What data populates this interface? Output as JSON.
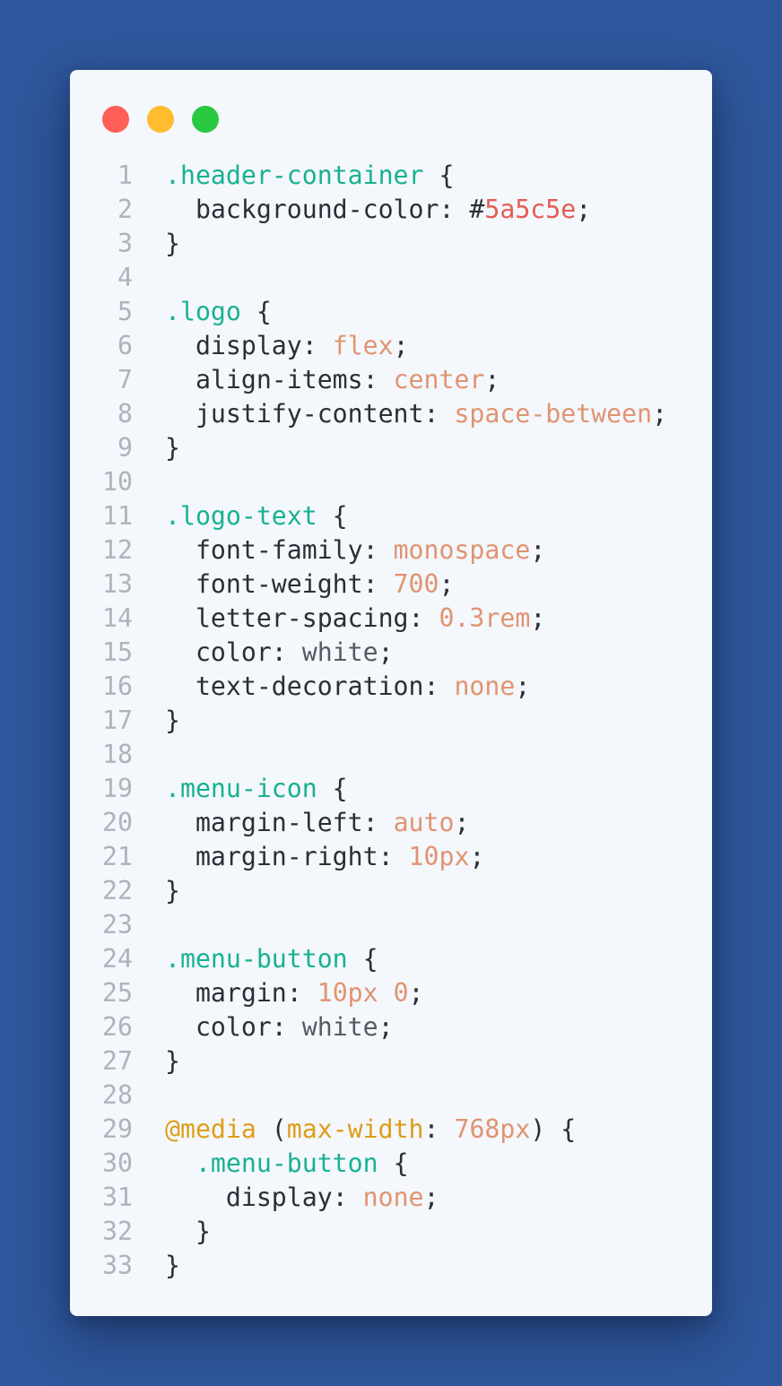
{
  "window": {
    "controls": [
      {
        "name": "close",
        "color": "#ff5f57"
      },
      {
        "name": "minimize",
        "color": "#febc2e"
      },
      {
        "name": "maximize",
        "color": "#28c840"
      }
    ]
  },
  "theme": {
    "background": "#2f579d",
    "panel": "#f4f7fb",
    "line_number": "#adb3bd",
    "selector": "#17b193",
    "value": "#e09472",
    "keyword": "#555a63",
    "hex": "#e65c52",
    "at_rule": "#de9d18",
    "text": "#2a2e36"
  },
  "code": {
    "language": "css",
    "lines": [
      {
        "n": "1",
        "tokens": [
          {
            "t": ".header-container",
            "c": "sel"
          },
          {
            "t": " {",
            "c": "punc"
          }
        ]
      },
      {
        "n": "2",
        "tokens": [
          {
            "t": "  background-color",
            "c": "prop"
          },
          {
            "t": ": #",
            "c": "punc"
          },
          {
            "t": "5a5c5e",
            "c": "hex"
          },
          {
            "t": ";",
            "c": "punc"
          }
        ]
      },
      {
        "n": "3",
        "tokens": [
          {
            "t": "}",
            "c": "punc"
          }
        ]
      },
      {
        "n": "4",
        "tokens": []
      },
      {
        "n": "5",
        "tokens": [
          {
            "t": ".logo",
            "c": "sel"
          },
          {
            "t": " {",
            "c": "punc"
          }
        ]
      },
      {
        "n": "6",
        "tokens": [
          {
            "t": "  display",
            "c": "prop"
          },
          {
            "t": ": ",
            "c": "punc"
          },
          {
            "t": "flex",
            "c": "val"
          },
          {
            "t": ";",
            "c": "punc"
          }
        ]
      },
      {
        "n": "7",
        "tokens": [
          {
            "t": "  align-items",
            "c": "prop"
          },
          {
            "t": ": ",
            "c": "punc"
          },
          {
            "t": "center",
            "c": "val"
          },
          {
            "t": ";",
            "c": "punc"
          }
        ]
      },
      {
        "n": "8",
        "tokens": [
          {
            "t": "  justify-content",
            "c": "prop"
          },
          {
            "t": ": ",
            "c": "punc"
          },
          {
            "t": "space-between",
            "c": "val"
          },
          {
            "t": ";",
            "c": "punc"
          }
        ]
      },
      {
        "n": "9",
        "tokens": [
          {
            "t": "}",
            "c": "punc"
          }
        ]
      },
      {
        "n": "10",
        "tokens": []
      },
      {
        "n": "11",
        "tokens": [
          {
            "t": ".logo-text",
            "c": "sel"
          },
          {
            "t": " {",
            "c": "punc"
          }
        ]
      },
      {
        "n": "12",
        "tokens": [
          {
            "t": "  font-family",
            "c": "prop"
          },
          {
            "t": ": ",
            "c": "punc"
          },
          {
            "t": "monospace",
            "c": "val"
          },
          {
            "t": ";",
            "c": "punc"
          }
        ]
      },
      {
        "n": "13",
        "tokens": [
          {
            "t": "  font-weight",
            "c": "prop"
          },
          {
            "t": ": ",
            "c": "punc"
          },
          {
            "t": "700",
            "c": "val"
          },
          {
            "t": ";",
            "c": "punc"
          }
        ]
      },
      {
        "n": "14",
        "tokens": [
          {
            "t": "  letter-spacing",
            "c": "prop"
          },
          {
            "t": ": ",
            "c": "punc"
          },
          {
            "t": "0.3rem",
            "c": "val"
          },
          {
            "t": ";",
            "c": "punc"
          }
        ]
      },
      {
        "n": "15",
        "tokens": [
          {
            "t": "  color",
            "c": "prop"
          },
          {
            "t": ": ",
            "c": "punc"
          },
          {
            "t": "white",
            "c": "kw"
          },
          {
            "t": ";",
            "c": "punc"
          }
        ]
      },
      {
        "n": "16",
        "tokens": [
          {
            "t": "  text-decoration",
            "c": "prop"
          },
          {
            "t": ": ",
            "c": "punc"
          },
          {
            "t": "none",
            "c": "val"
          },
          {
            "t": ";",
            "c": "punc"
          }
        ]
      },
      {
        "n": "17",
        "tokens": [
          {
            "t": "}",
            "c": "punc"
          }
        ]
      },
      {
        "n": "18",
        "tokens": []
      },
      {
        "n": "19",
        "tokens": [
          {
            "t": ".menu-icon",
            "c": "sel"
          },
          {
            "t": " {",
            "c": "punc"
          }
        ]
      },
      {
        "n": "20",
        "tokens": [
          {
            "t": "  margin-left",
            "c": "prop"
          },
          {
            "t": ": ",
            "c": "punc"
          },
          {
            "t": "auto",
            "c": "val"
          },
          {
            "t": ";",
            "c": "punc"
          }
        ]
      },
      {
        "n": "21",
        "tokens": [
          {
            "t": "  margin-right",
            "c": "prop"
          },
          {
            "t": ": ",
            "c": "punc"
          },
          {
            "t": "10px",
            "c": "val"
          },
          {
            "t": ";",
            "c": "punc"
          }
        ]
      },
      {
        "n": "22",
        "tokens": [
          {
            "t": "}",
            "c": "punc"
          }
        ]
      },
      {
        "n": "23",
        "tokens": []
      },
      {
        "n": "24",
        "tokens": [
          {
            "t": ".menu-button",
            "c": "sel"
          },
          {
            "t": " {",
            "c": "punc"
          }
        ]
      },
      {
        "n": "25",
        "tokens": [
          {
            "t": "  margin",
            "c": "prop"
          },
          {
            "t": ": ",
            "c": "punc"
          },
          {
            "t": "10px 0",
            "c": "val"
          },
          {
            "t": ";",
            "c": "punc"
          }
        ]
      },
      {
        "n": "26",
        "tokens": [
          {
            "t": "  color",
            "c": "prop"
          },
          {
            "t": ": ",
            "c": "punc"
          },
          {
            "t": "white",
            "c": "kw"
          },
          {
            "t": ";",
            "c": "punc"
          }
        ]
      },
      {
        "n": "27",
        "tokens": [
          {
            "t": "}",
            "c": "punc"
          }
        ]
      },
      {
        "n": "28",
        "tokens": []
      },
      {
        "n": "29",
        "tokens": [
          {
            "t": "@media",
            "c": "at"
          },
          {
            "t": " (",
            "c": "punc"
          },
          {
            "t": "max-width",
            "c": "at"
          },
          {
            "t": ": ",
            "c": "punc"
          },
          {
            "t": "768px",
            "c": "val"
          },
          {
            "t": ") {",
            "c": "punc"
          }
        ]
      },
      {
        "n": "30",
        "tokens": [
          {
            "t": "  ",
            "c": "punc"
          },
          {
            "t": ".menu-button",
            "c": "sel"
          },
          {
            "t": " {",
            "c": "punc"
          }
        ]
      },
      {
        "n": "31",
        "tokens": [
          {
            "t": "    display",
            "c": "prop"
          },
          {
            "t": ": ",
            "c": "punc"
          },
          {
            "t": "none",
            "c": "val"
          },
          {
            "t": ";",
            "c": "punc"
          }
        ]
      },
      {
        "n": "32",
        "tokens": [
          {
            "t": "  }",
            "c": "punc"
          }
        ]
      },
      {
        "n": "33",
        "tokens": [
          {
            "t": "}",
            "c": "punc"
          }
        ]
      }
    ]
  }
}
